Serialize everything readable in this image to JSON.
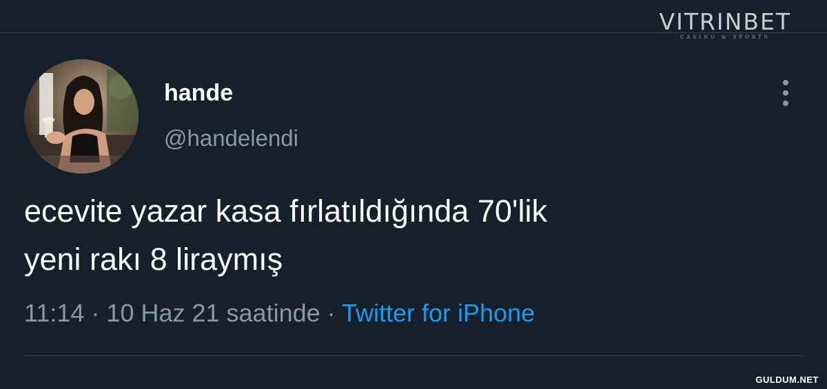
{
  "watermark": {
    "brand": "VITRINBET",
    "tagline": "CASINO & SPORTS"
  },
  "tweet": {
    "avatar_icon": "profile-photo",
    "display_name": "hande",
    "handle": "@handelendi",
    "more_icon": "vertical-ellipsis-icon",
    "text_lines": [
      "ecevite yazar kasa fırlatıldığında 70'lik",
      "yeni rakı 8 liraymış"
    ],
    "time": "11:14",
    "separator": " · ",
    "date": "10 Haz 21 saatinde",
    "source": "Twitter for iPhone"
  },
  "footer": {
    "site": "GULDUM.NET"
  },
  "colors": {
    "background": "#15202b",
    "text": "#ffffff",
    "secondary": "#8b98a5",
    "link": "#1d9bf0",
    "divider": "#38444d"
  }
}
